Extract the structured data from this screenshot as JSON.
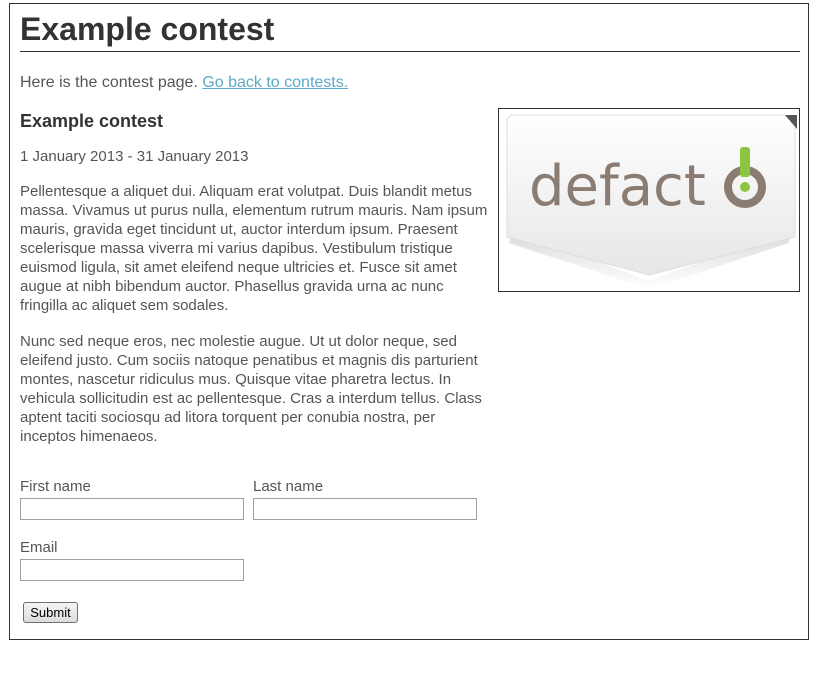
{
  "page": {
    "title": "Example contest",
    "intro_text": "Here is the contest page. ",
    "back_link": "Go back to contests."
  },
  "contest": {
    "heading": "Example contest",
    "dates": "1 January 2013 - 31 January 2013",
    "paragraphs": [
      "Pellentesque a aliquet dui. Aliquam erat volutpat. Duis blandit metus massa. Vivamus ut purus nulla, elementum rutrum mauris. Nam ipsum mauris, gravida eget tincidunt ut, auctor interdum ipsum. Praesent scelerisque massa viverra mi varius dapibus. Vestibulum tristique euismod ligula, sit amet eleifend neque ultricies et. Fusce sit amet augue at nibh bibendum auctor. Phasellus gravida urna ac nunc fringilla ac aliquet sem sodales.",
      "Nunc sed neque eros, nec molestie augue. Ut ut dolor neque, sed eleifend justo. Cum sociis natoque penatibus et magnis dis parturient montes, nascetur ridiculus mus. Quisque vitae pharetra lectus. In vehicula sollicitudin est ac pellentesque. Cras a interdum tellus. Class aptent taciti sociosqu ad litora torquent per conubia nostra, per inceptos himenaeos."
    ],
    "logo": {
      "text_dark": "defact",
      "accent_color": "#8cc63f",
      "text_color": "#8a7c72"
    }
  },
  "form": {
    "first_name_label": "First name",
    "first_name_value": "",
    "last_name_label": "Last name",
    "last_name_value": "",
    "email_label": "Email",
    "email_value": "",
    "submit_label": "Submit"
  }
}
